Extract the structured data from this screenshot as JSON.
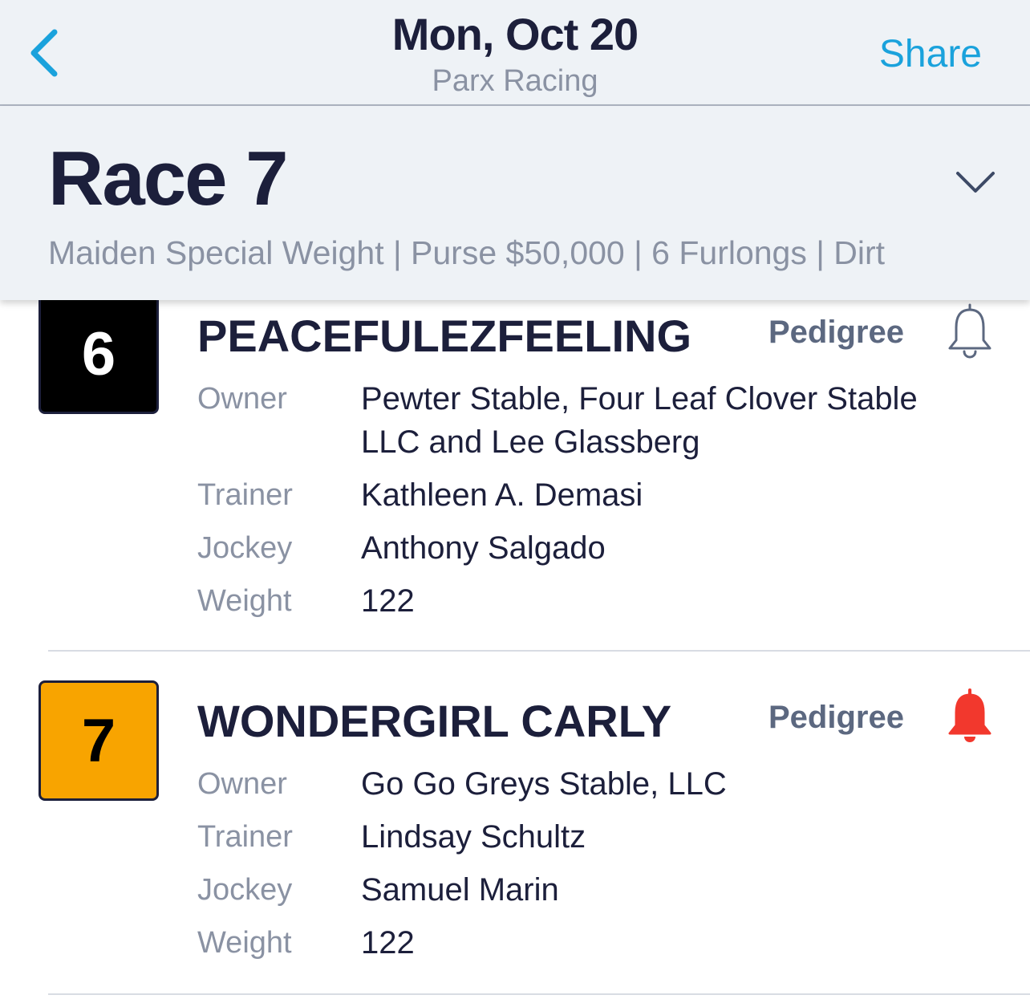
{
  "nav": {
    "title": "Mon, Oct 20",
    "subtitle": "Parx Racing",
    "share_label": "Share",
    "back_icon": "chevron-left-icon",
    "accent_color": "#1aa2dc"
  },
  "race": {
    "title": "Race 7",
    "info": "Maiden Special Weight | Purse $50,000 | 6 Furlongs | Dirt",
    "toggle_icon": "chevron-down-icon"
  },
  "labels": {
    "owner": "Owner",
    "trainer": "Trainer",
    "jockey": "Jockey",
    "weight": "Weight",
    "pedigree": "Pedigree"
  },
  "entries": [
    {
      "number": "6",
      "name": "PEACEFULEZFEELING",
      "owner": "Pewter Stable, Four Leaf Clover Stable LLC and Lee Glassberg",
      "trainer": "Kathleen A. Demasi",
      "jockey": "Anthony Salgado",
      "weight": "122",
      "saddlecloth_color": "#000000",
      "number_color": "#ffffff",
      "alert_active": false,
      "bell_icon": "bell-outline-icon"
    },
    {
      "number": "7",
      "name": "WONDERGIRL CARLY",
      "owner": "Go Go Greys Stable, LLC",
      "trainer": "Lindsay Schultz",
      "jockey": "Samuel Marin",
      "weight": "122",
      "saddlecloth_color": "#f8a400",
      "number_color": "#000000",
      "alert_active": true,
      "bell_icon": "bell-filled-icon",
      "alert_color": "#f2382d"
    }
  ]
}
